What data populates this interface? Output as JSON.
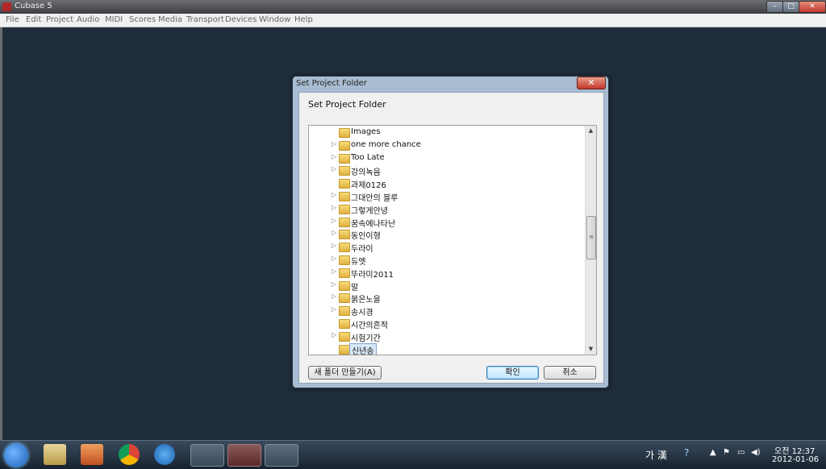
{
  "window": {
    "title": "Cubase 5"
  },
  "window_controls": {
    "minimize": "–",
    "maximize": "□",
    "close": "✕"
  },
  "menu": [
    "File",
    "Edit",
    "Project",
    "Audio",
    "MIDI",
    "Scores",
    "Media",
    "Transport",
    "Devices",
    "Window",
    "Help"
  ],
  "dialog": {
    "title": "Set Project Folder",
    "close_label": "✕",
    "heading": "Set Project Folder",
    "folders": [
      {
        "label": "Images",
        "has_children": false
      },
      {
        "label": "one more chance",
        "has_children": true
      },
      {
        "label": "Too Late",
        "has_children": true
      },
      {
        "label": "강의녹음",
        "has_children": true
      },
      {
        "label": "과제0126",
        "has_children": false
      },
      {
        "label": "그대안의 블루",
        "has_children": true
      },
      {
        "label": "그렇게안녕",
        "has_children": true
      },
      {
        "label": "꿈속에나타난",
        "has_children": true
      },
      {
        "label": "동인이형",
        "has_children": true
      },
      {
        "label": "두라이",
        "has_children": true
      },
      {
        "label": "듀엣",
        "has_children": true
      },
      {
        "label": "뚜라미2011",
        "has_children": true
      },
      {
        "label": "말",
        "has_children": true
      },
      {
        "label": "붉은노을",
        "has_children": true
      },
      {
        "label": "송시경",
        "has_children": true
      },
      {
        "label": "시간의흔적",
        "has_children": false
      },
      {
        "label": "시험기간",
        "has_children": true
      },
      {
        "label": "신년송",
        "has_children": false,
        "selected": true
      }
    ],
    "new_folder_button": "새 폴더 만들기(A)",
    "ok_button": "확인",
    "cancel_button": "취소"
  },
  "taskbar": {
    "ime": "가 漢",
    "time": "오전 12:37",
    "date": "2012-01-06"
  }
}
